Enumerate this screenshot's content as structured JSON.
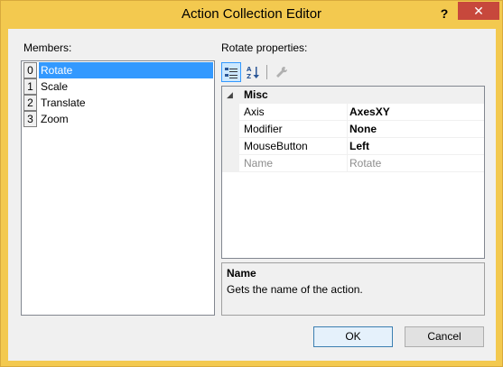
{
  "window": {
    "title": "Action Collection Editor",
    "help_glyph": "?",
    "close_glyph": "✕"
  },
  "members": {
    "label": "Members:",
    "items": [
      {
        "index": "0",
        "label": "Rotate",
        "selected": true
      },
      {
        "index": "1",
        "label": "Scale",
        "selected": false
      },
      {
        "index": "2",
        "label": "Translate",
        "selected": false
      },
      {
        "index": "3",
        "label": "Zoom",
        "selected": false
      }
    ]
  },
  "properties": {
    "label": "Rotate properties:",
    "toolbar": {
      "categorized_icon": "categorized-icon",
      "alphabetical_icon": "alphabetical-icon",
      "property_pages_icon": "wrench-icon"
    },
    "category": {
      "name": "Misc",
      "toggle": "◢"
    },
    "rows": [
      {
        "name": "Axis",
        "value": "AxesXY",
        "bold": true,
        "readonly": false
      },
      {
        "name": "Modifier",
        "value": "None",
        "bold": true,
        "readonly": false
      },
      {
        "name": "MouseButton",
        "value": "Left",
        "bold": true,
        "readonly": false
      },
      {
        "name": "Name",
        "value": "Rotate",
        "bold": false,
        "readonly": true
      }
    ],
    "description": {
      "title": "Name",
      "text": "Gets the name of the action."
    }
  },
  "buttons": {
    "ok": "OK",
    "cancel": "Cancel"
  },
  "colors": {
    "titlebar": "#f3c94f",
    "close": "#c7483c",
    "selection": "#3399ff"
  }
}
